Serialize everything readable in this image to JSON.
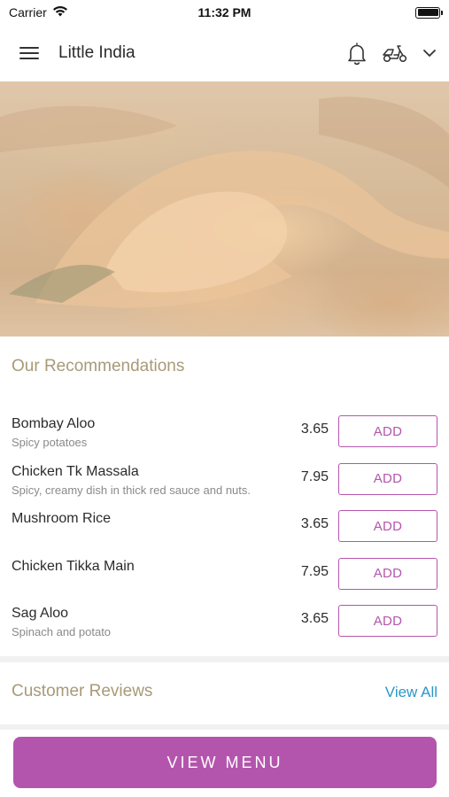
{
  "status_bar": {
    "carrier": "Carrier",
    "time": "11:32 PM",
    "wifi_icon": "wifi-icon",
    "battery_icon": "battery-icon"
  },
  "app_bar": {
    "title": "Little India",
    "menu_icon": "hamburger-menu-icon",
    "notification_icon": "bell-icon",
    "delivery_icon": "scooter-icon",
    "dropdown_icon": "chevron-down-icon"
  },
  "hero": {
    "image": "prawn-curry-photo"
  },
  "recommendations": {
    "title": "Our Recommendations",
    "items": [
      {
        "name": "Bombay Aloo",
        "description": "Spicy potatoes",
        "price": "3.65",
        "add_label": "ADD"
      },
      {
        "name": "Chicken Tk Massala",
        "description": "Spicy, creamy dish in thick red sauce and nuts.",
        "price": "7.95",
        "add_label": "ADD"
      },
      {
        "name": "Mushroom Rice",
        "description": "",
        "price": "3.65",
        "add_label": "ADD"
      },
      {
        "name": "Chicken Tikka Main",
        "description": "",
        "price": "7.95",
        "add_label": "ADD"
      },
      {
        "name": "Sag Aloo",
        "description": "Spinach and potato",
        "price": "3.65",
        "add_label": "ADD"
      }
    ]
  },
  "reviews": {
    "title": "Customer Reviews",
    "view_all_label": "View All"
  },
  "footer": {
    "view_menu_label": "VIEW MENU"
  },
  "colors": {
    "accent": "#b455ad",
    "section_title": "#a89a78",
    "link": "#2a97c9"
  }
}
